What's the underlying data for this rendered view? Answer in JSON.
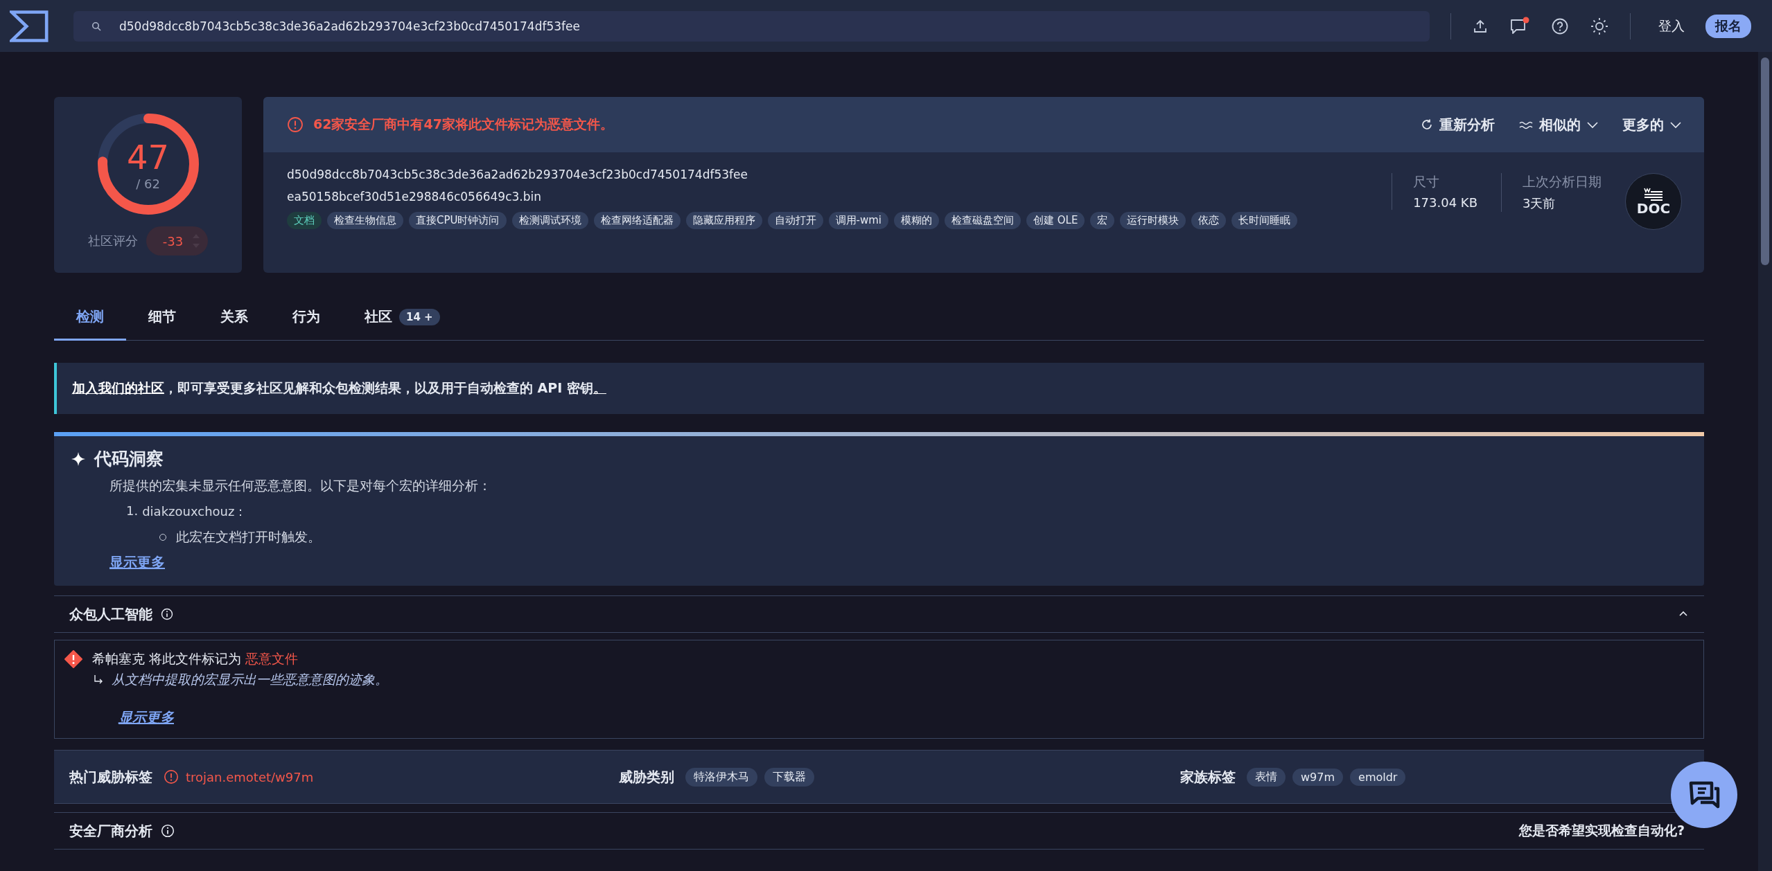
{
  "search": {
    "value": "d50d98dcc8b7043cb5c38c3de36a2ad62b293704e3cf23b0cd7450174df53fee"
  },
  "notifications": {
    "unread": true
  },
  "account": {
    "sign_in": "登入",
    "sign_up": "报名"
  },
  "score": {
    "detections": "47",
    "total": "/ 62",
    "level": 0.758,
    "community_label": "社区评分",
    "community_score": "-33"
  },
  "alert": "62家安全厂商中有47家将此文件标记为恶意文件。",
  "actions": [
    {
      "label": "重新分析",
      "kind": "reanalyze"
    },
    {
      "label": "相似的",
      "kind": "similar"
    },
    {
      "label": "更多的",
      "kind": "more"
    }
  ],
  "file": {
    "hash": "d50d98dcc8b7043cb5c38c3de36a2ad62b293704e3cf23b0cd7450174df53fee",
    "name": "ea50158bcef30d51e298846c056649c3.bin",
    "size_label": "尺寸",
    "size": "173.04 KB",
    "date_label": "上次分析日期",
    "date": "3天前",
    "type": "DOC"
  },
  "tags": [
    {
      "label": "文档",
      "kind": "file-type"
    },
    {
      "label": "检查生物信息",
      "kind": "behavior"
    },
    {
      "label": "直接CPU时钟访问",
      "kind": "behavior"
    },
    {
      "label": "检测调试环境",
      "kind": "behavior"
    },
    {
      "label": "检查网络适配器",
      "kind": "behavior"
    },
    {
      "label": "隐藏应用程序",
      "kind": "behavior"
    },
    {
      "label": "自动打开",
      "kind": "behavior"
    },
    {
      "label": "调用-wmi",
      "kind": "behavior"
    },
    {
      "label": "模糊的",
      "kind": "behavior"
    },
    {
      "label": "检查磁盘空间",
      "kind": "behavior"
    },
    {
      "label": "创建 OLE",
      "kind": "behavior"
    },
    {
      "label": "宏",
      "kind": "behavior"
    },
    {
      "label": "运行时模块",
      "kind": "behavior"
    },
    {
      "label": "依恋",
      "kind": "behavior"
    },
    {
      "label": "长时间睡眠",
      "kind": "behavior"
    }
  ],
  "tabs": [
    {
      "label": "检测",
      "selected": true
    },
    {
      "label": "细节",
      "selected": false
    },
    {
      "label": "关系",
      "selected": false
    },
    {
      "label": "行为",
      "selected": false
    },
    {
      "label": "社区",
      "selected": false,
      "badge": "14 +"
    }
  ],
  "banner": {
    "link": "加入我们的社区",
    "text": "，即可享受更多社区见解和众包检测结果，以及用于自动检查的 API 密钥",
    "end_link": "。"
  },
  "code_insight": {
    "title": "代码洞察",
    "summary": "所提供的宏集未显示任何恶意意图。以下是对每个宏的详细分析：",
    "items": [
      {
        "number": "1.",
        "name": "diakzouxchouz：",
        "children": [
          {
            "text": "此宏在文档打开时触发。"
          }
        ]
      }
    ],
    "show_more": "显示更多"
  },
  "crowdsourced_ai": {
    "title": "众包人工智能",
    "expanded": true,
    "entries": [
      {
        "source": "希帕塞克",
        "text": "将此文件标记为",
        "verdict": "恶意文件",
        "detail": "从文档中提取的宏显示出一些恶意意图的迹象。",
        "show_more": "显示更多"
      }
    ]
  },
  "threat": {
    "label_title": "热门威胁标签",
    "label": "trojan.emotet/w97m",
    "category_title": "威胁类别",
    "categories": [
      "特洛伊木马",
      "下载器"
    ],
    "family_title": "家族标签",
    "families": [
      "表情",
      "w97m",
      "emoldr"
    ]
  },
  "vendors": {
    "title": "安全厂商分析",
    "automation_prompt": "您是否希望实现检查自动化?"
  }
}
